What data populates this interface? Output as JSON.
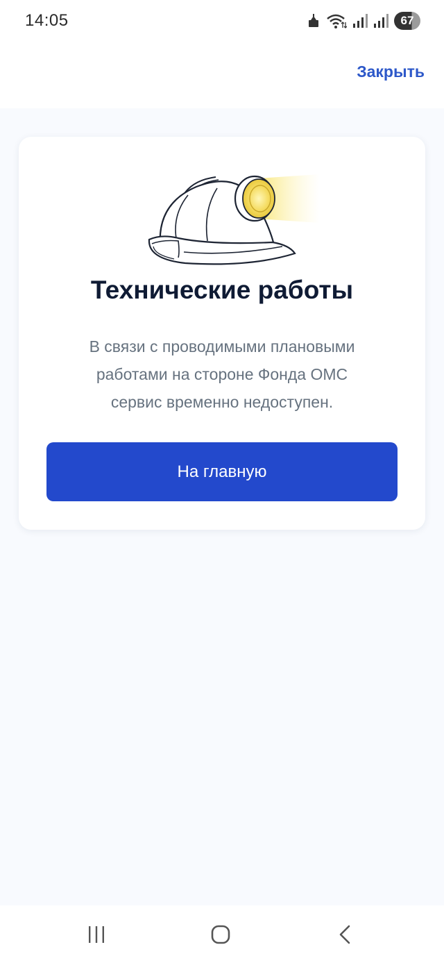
{
  "status_bar": {
    "time": "14:05",
    "battery_level": "67",
    "icons": [
      "notification-icon",
      "wifi-icon",
      "signal-icon",
      "signal-icon-2",
      "battery-icon"
    ]
  },
  "header": {
    "close_label": "Закрыть"
  },
  "card": {
    "illustration": "helmet-with-lamp-icon",
    "title": "Технические работы",
    "message_lines": [
      "В связи с проводимыми плановыми",
      "работами на стороне Фонда ОМС",
      "сервис временно недоступен."
    ],
    "button_label": "На главную"
  },
  "nav_bar": {
    "icons": [
      "recent-apps-icon",
      "home-icon",
      "back-icon"
    ]
  },
  "colors": {
    "accent": "#2349cc",
    "link": "#2d58c9",
    "title": "#0f1b34",
    "text": "#66727f",
    "background": "#f8fafe"
  }
}
